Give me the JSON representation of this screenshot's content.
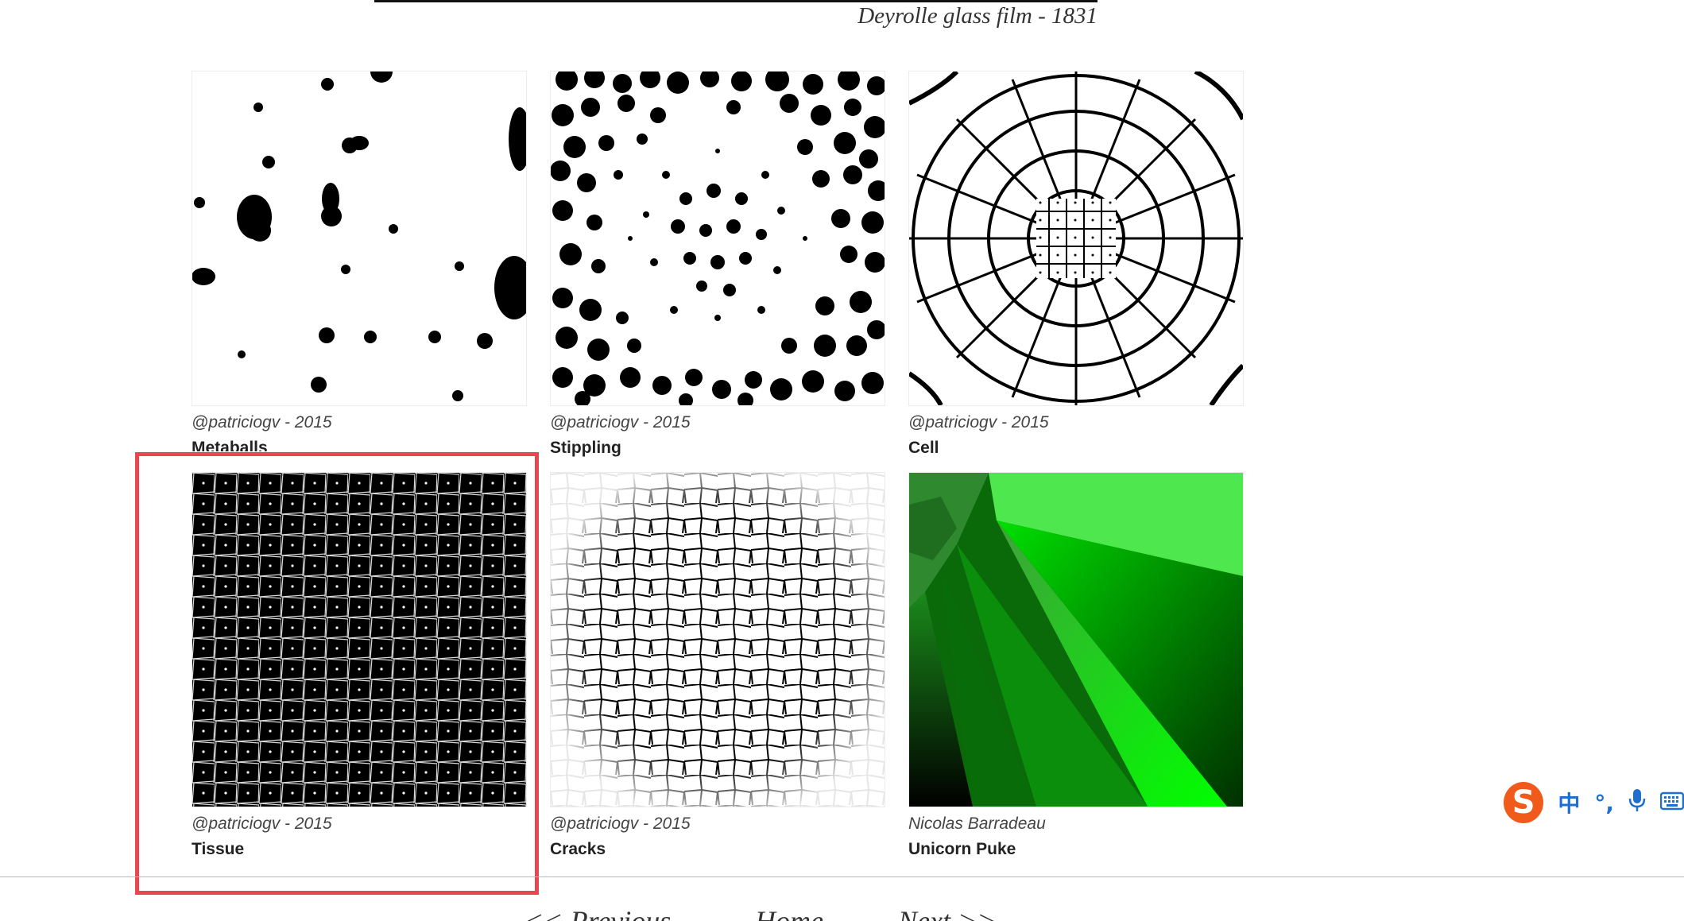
{
  "header": {
    "caption": "Deyrolle glass film - 1831"
  },
  "gallery": [
    {
      "author": "@patriciogv - 2015",
      "title": "Metaballs",
      "icon": "metaballs-thumbnail"
    },
    {
      "author": "@patriciogv - 2015",
      "title": "Stippling",
      "icon": "stippling-thumbnail"
    },
    {
      "author": "@patriciogv - 2015",
      "title": "Cell",
      "icon": "cell-thumbnail"
    },
    {
      "author": "@patriciogv - 2015",
      "title": "Tissue",
      "icon": "tissue-thumbnail"
    },
    {
      "author": "@patriciogv - 2015",
      "title": "Cracks",
      "icon": "cracks-thumbnail"
    },
    {
      "author": "Nicolas Barradeau",
      "title": "Unicorn Puke",
      "icon": "unicorn-puke-thumbnail"
    }
  ],
  "pager": {
    "prev": "<< Previous",
    "home": "Home",
    "next": "Next >>"
  },
  "ime": {
    "logo": "S",
    "lang": "中",
    "punct": "°,",
    "mic_icon": "microphone-icon",
    "keyboard_icon": "keyboard-icon"
  },
  "colors": {
    "highlight": "#e8474f",
    "ime_accent": "#1e6fd1",
    "ime_logo": "#f05a1a"
  }
}
